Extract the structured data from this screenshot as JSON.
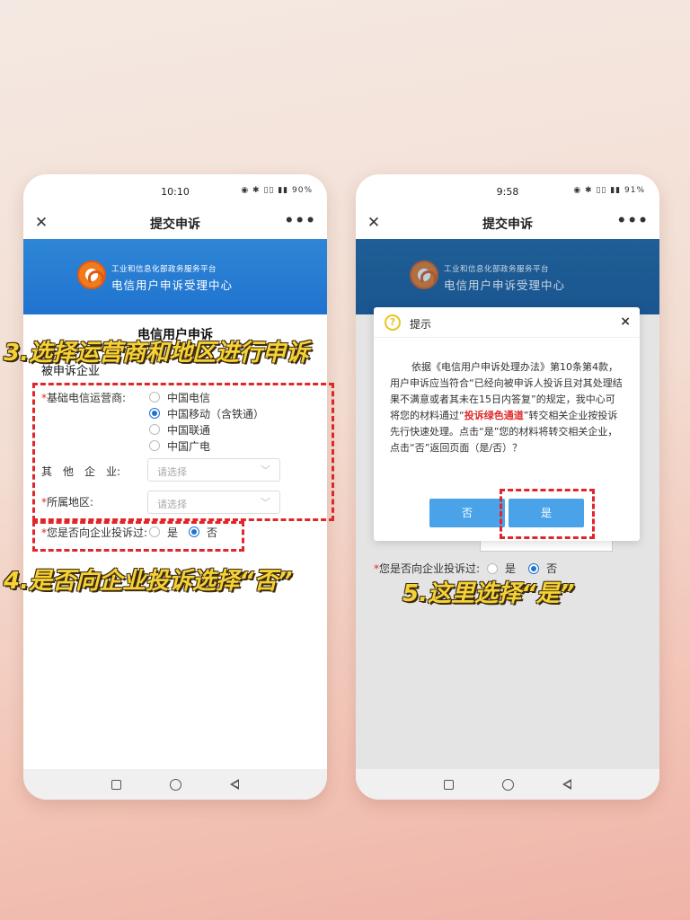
{
  "left_phone": {
    "status": {
      "time": "10:10",
      "icons": "◉ ✱ ▯▯ ▮▮ 90%"
    },
    "titlebar": {
      "close": "✕",
      "title": "提交申诉",
      "more": "•••"
    },
    "banner": {
      "subtitle": "工业和信息化部政务服务平台",
      "title": "电信用户申诉受理中心"
    },
    "form": {
      "title": "电信用户申诉",
      "section": "被申诉企业",
      "carrier_label": "基础电信运营商:",
      "carriers": [
        {
          "label": "中国电信",
          "checked": false
        },
        {
          "label": "中国移动（含铁通）",
          "checked": true
        },
        {
          "label": "中国联通",
          "checked": false
        },
        {
          "label": "中国广电",
          "checked": false
        }
      ],
      "other_label": "其　他　企　业:",
      "other_placeholder": "请选择",
      "region_label": "所属地区:",
      "region_placeholder": "请选择",
      "complained_label": "您是否向企业投诉过:",
      "yes": "是",
      "no": "否",
      "required_mark": "*"
    }
  },
  "right_phone": {
    "status": {
      "time": "9:58",
      "icons": "◉ ✱ ▯▯ ▮▮ 91%"
    },
    "titlebar": {
      "close": "✕",
      "title": "提交申诉",
      "more": "•••"
    },
    "banner": {
      "subtitle": "工业和信息化部政务服务平台",
      "title": "电信用户申诉受理中心"
    },
    "dialog": {
      "icon": "?",
      "title": "提示",
      "close": "×",
      "text_before": "依据《电信用户申诉处理办法》第10条第4款，用户申诉应当符合“已经向被申诉人投诉且对其处理结果不满意或者其未在15日内答复”的规定，我中心可将您的材料通过“",
      "highlight": "投诉绿色通道",
      "text_after": "”转交相关企业按投诉先行快速处理。点击“是”您的材料将转交相关企业，点击“否”返回页面（是/否）？",
      "no_button": "否",
      "yes_button": "是"
    },
    "complained_label": "您是否向企业投诉过:",
    "yes": "是",
    "no": "否",
    "required_mark": "*"
  },
  "annotations": {
    "step3": "3.选择运营商和地区进行申诉",
    "step4": "4.是否向企业投诉选择“否”",
    "step5": "5.这里选择“是”"
  },
  "colors": {
    "brand_blue": "#1f73cf",
    "highlight_red": "#e02b2b",
    "annotation_yellow": "#f7d234"
  }
}
